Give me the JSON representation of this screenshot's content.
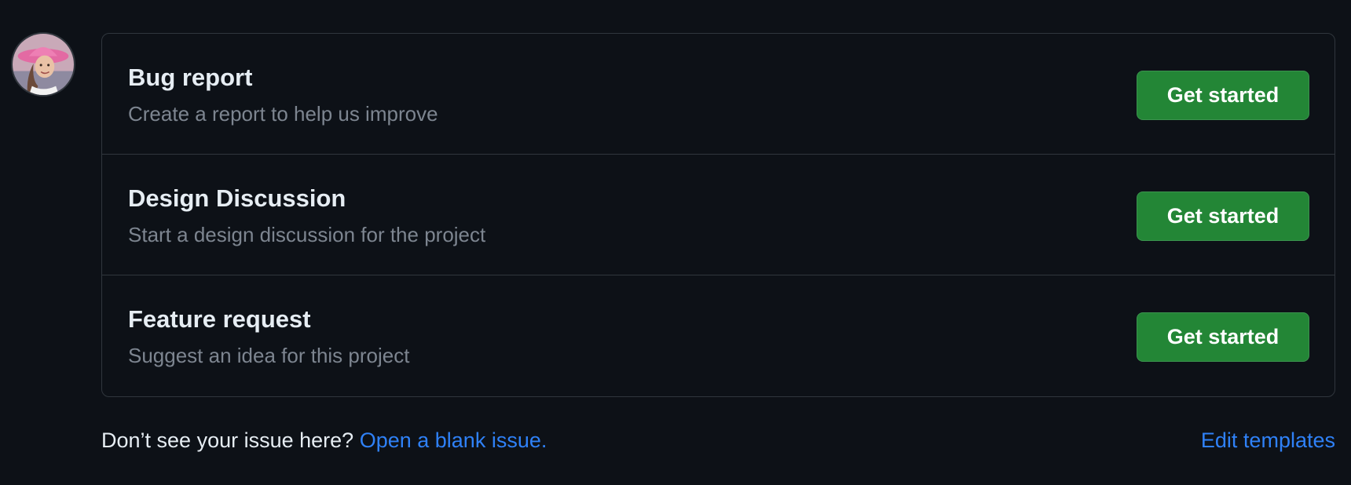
{
  "user": {
    "avatar_icon": "user-avatar"
  },
  "templates": [
    {
      "title": "Bug report",
      "description": "Create a report to help us improve",
      "button_label": "Get started"
    },
    {
      "title": "Design Discussion",
      "description": "Start a design discussion for the project",
      "button_label": "Get started"
    },
    {
      "title": "Feature request",
      "description": "Suggest an idea for this project",
      "button_label": "Get started"
    }
  ],
  "footer": {
    "prompt": "Don’t see your issue here?",
    "blank_issue_link": "Open a blank issue.",
    "edit_templates_link": "Edit templates"
  },
  "colors": {
    "background": "#0d1117",
    "border": "#30363d",
    "primary_button": "#238636",
    "link": "#2f81f7",
    "muted_text": "#7d8590"
  }
}
